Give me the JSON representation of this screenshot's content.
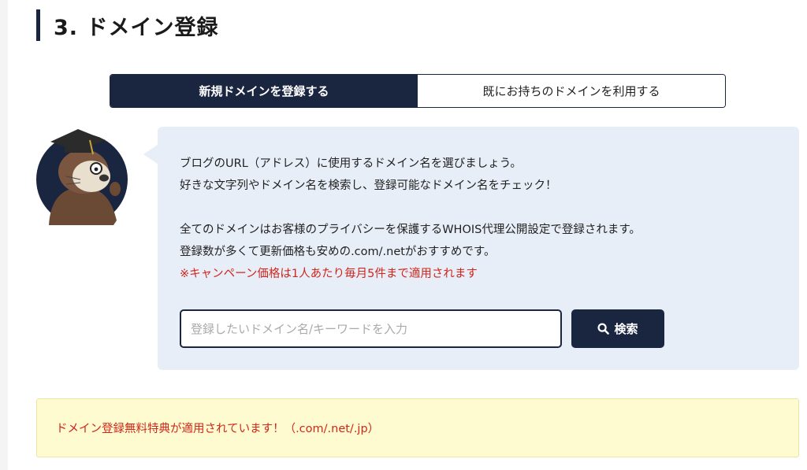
{
  "heading": {
    "title": "3. ドメイン登録"
  },
  "tabs": [
    {
      "label": "新規ドメインを登録する",
      "active": true
    },
    {
      "label": "既にお持ちのドメインを利用する",
      "active": false
    }
  ],
  "mascot": {
    "icon": "sea-otter-mascot-icon"
  },
  "info": {
    "line1": "ブログのURL（アドレス）に使用するドメイン名を選びましょう。",
    "line2": "好きな文字列やドメイン名を検索し、登録可能なドメイン名をチェック！",
    "line3": "全てのドメインはお客様のプライバシーを保護するWHOIS代理公開設定で登録されます。",
    "line4": "登録数が多くて更新価格も安めの.com/.netがおすすめです。",
    "campaign_note": "※キャンペーン価格は1人あたり毎月5件まで適用されます"
  },
  "search": {
    "placeholder": "登録したいドメイン名/キーワードを入力",
    "value": "",
    "button_label": "検索",
    "button_icon": "search-icon"
  },
  "notice": {
    "text": "ドメイン登録無料特典が適用されています！（.com/.net/.jp）"
  },
  "colors": {
    "navy": "#1a2540",
    "bubble_bg": "#e8eef8",
    "notice_bg": "#fffbd0",
    "alert_red": "#d0261c"
  }
}
